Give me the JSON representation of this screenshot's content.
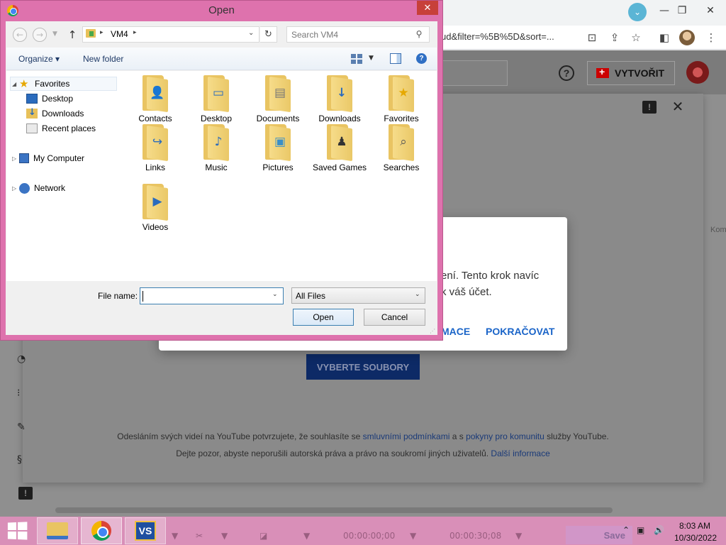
{
  "browser": {
    "url_fragment": "ud&filter=%5B%5D&sort=...",
    "window_controls": {
      "minimize": "—",
      "restore": "❐",
      "close": "✕"
    },
    "tab_search_glyph": "⌄"
  },
  "youtube": {
    "create_label": "VYTVOŘIT",
    "help_glyph": "?",
    "select_files_label": "VYBERTE SOUBORY",
    "terms": {
      "line1_before": "Odesláním svých videí na YouTube potvrzujete, že souhlasíte se ",
      "line1_link1": "smluvními podmínkami",
      "line1_between": " a s ",
      "line1_link2": "pokyny pro komunitu",
      "line1_after": " služby YouTube.",
      "line2_before": "Dejte pozor, abyste neporušili autorská práva a právo na soukromí jiných uživatelů. ",
      "line2_link": "Další informace"
    },
    "side_label": "Kom",
    "feedback_glyph": "!"
  },
  "consent_dialog": {
    "line1": "ení. Tento krok navíc",
    "line2": "k váš účet.",
    "more_label": "MACE",
    "continue_label": "POKRAČOVAT"
  },
  "open_dialog": {
    "title": "Open",
    "address": {
      "crumb": "VM4"
    },
    "search_placeholder": "Search VM4",
    "toolbar": {
      "organize_label": "Organize ▾",
      "new_folder_label": "New folder"
    },
    "nav_pane": {
      "favorites_label": "Favorites",
      "favorites_children": [
        "Desktop",
        "Downloads",
        "Recent places"
      ],
      "my_computer_label": "My Computer",
      "network_label": "Network"
    },
    "items": [
      {
        "label": "Contacts",
        "glyph": "👤"
      },
      {
        "label": "Desktop",
        "glyph": "▭"
      },
      {
        "label": "Documents",
        "glyph": "▤"
      },
      {
        "label": "Downloads",
        "glyph": "↓"
      },
      {
        "label": "Favorites",
        "glyph": "★"
      },
      {
        "label": "Links",
        "glyph": "↪"
      },
      {
        "label": "Music",
        "glyph": "♪"
      },
      {
        "label": "Pictures",
        "glyph": "▣"
      },
      {
        "label": "Saved Games",
        "glyph": "♟"
      },
      {
        "label": "Searches",
        "glyph": "⌕"
      },
      {
        "label": "Videos",
        "glyph": "▶"
      }
    ],
    "footer": {
      "file_name_label": "File name:",
      "file_name_value": "",
      "file_type_value": "All Files",
      "open_label": "Open",
      "cancel_label": "Cancel"
    }
  },
  "taskbar": {
    "time_a": "00:00:00;00",
    "time_b": "00:00:30;08",
    "save_label": "Save",
    "clock_time": "8:03 AM",
    "clock_date": "10/30/2022"
  }
}
